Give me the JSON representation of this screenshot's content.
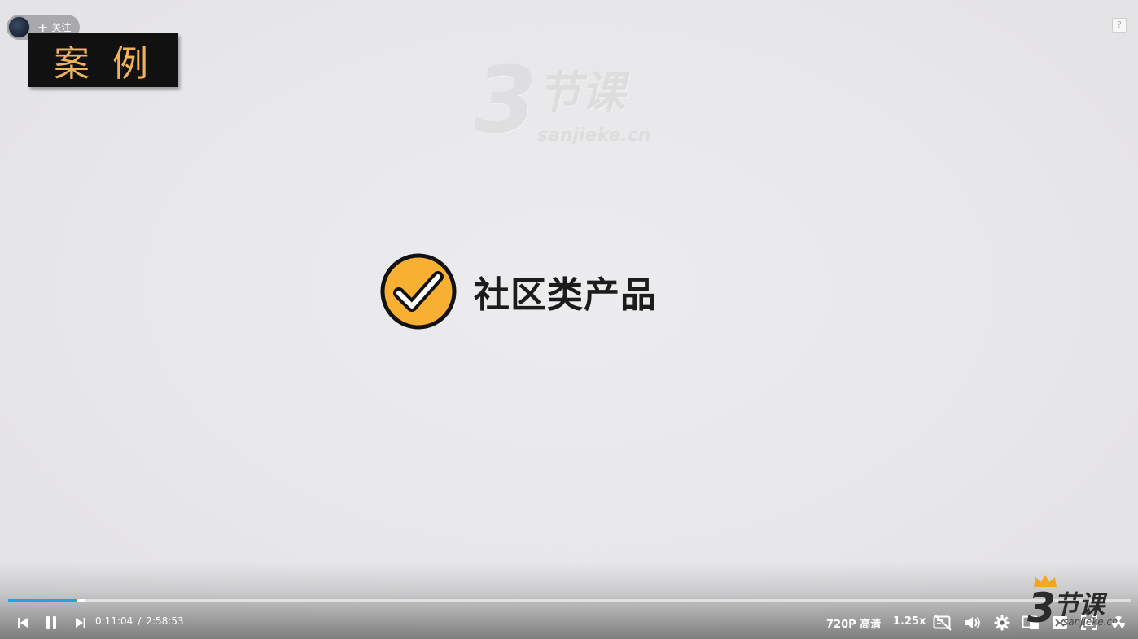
{
  "watermark": {
    "digit": "3",
    "name": "节课",
    "url": "sanjieke.cn"
  },
  "uploader": {
    "follow_label": "关注",
    "follow_icon": "plus-icon"
  },
  "case_label": "案例",
  "help_label": "?",
  "slide": {
    "title": "社区类产品",
    "icon": "check-circle-icon",
    "icon_color": "#f7b032"
  },
  "player": {
    "current_time": "0:11:04",
    "separator": "/",
    "duration": "2:58:53",
    "progress_fraction": 0.0619,
    "buffered_fraction": 0.068,
    "accent_color": "#24a1de",
    "quality_label": "720P 高清",
    "speed_label": "1.25x",
    "icons": [
      "previous-icon",
      "pause-icon",
      "next-icon",
      "danmaku-off-icon",
      "volume-icon",
      "settings-icon",
      "picture-in-picture-icon",
      "web-fullscreen-icon",
      "fullscreen-icon",
      "radiation-icon"
    ]
  },
  "brand_logo": {
    "digit": "3",
    "name": "节课",
    "url": "sanjieke.cn"
  }
}
